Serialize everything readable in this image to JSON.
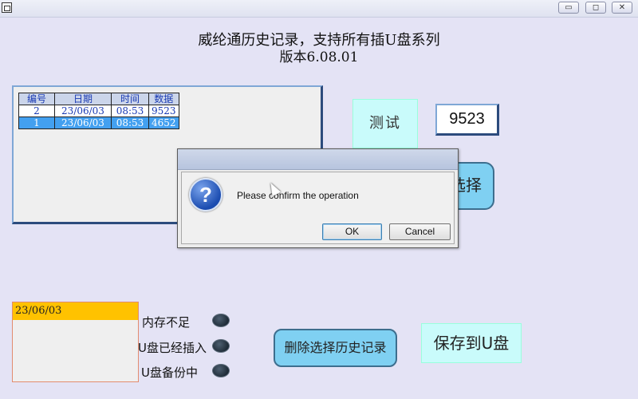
{
  "window": {
    "min_glyph": "▭",
    "max_glyph": "◻",
    "close_glyph": "✕"
  },
  "title_line1": "威纶通历史记录，支持所有插U盘系列",
  "title_line2": "版本6.08.01",
  "history_table": {
    "headers": [
      "编号",
      "日期",
      "时间",
      "数据"
    ],
    "rows": [
      [
        "2",
        "23/06/03",
        "08:53",
        "9523"
      ],
      [
        "1",
        "23/06/03",
        "08:53",
        "4652"
      ]
    ],
    "selected_row": 1
  },
  "test_button": "测试",
  "value_display": "9523",
  "select_button": "选择",
  "dialog": {
    "message": "Please confirm the operation",
    "ok": "OK",
    "cancel": "Cancel",
    "icon": "question-icon"
  },
  "date_panel": {
    "selected": "23/06/03"
  },
  "status": {
    "memory_low": "内存不足",
    "usb_inserted": "U盘已经插入",
    "usb_backup": "U盘备份中"
  },
  "delete_button": "删除选择历史记录",
  "save_button": "保存到U盘",
  "colors": {
    "background": "#e4e3f5",
    "button_blue": "#7fd0f2",
    "button_cyan": "#c9fbfb",
    "selected_row": "#43a0f0",
    "date_bar": "#ffc200"
  }
}
